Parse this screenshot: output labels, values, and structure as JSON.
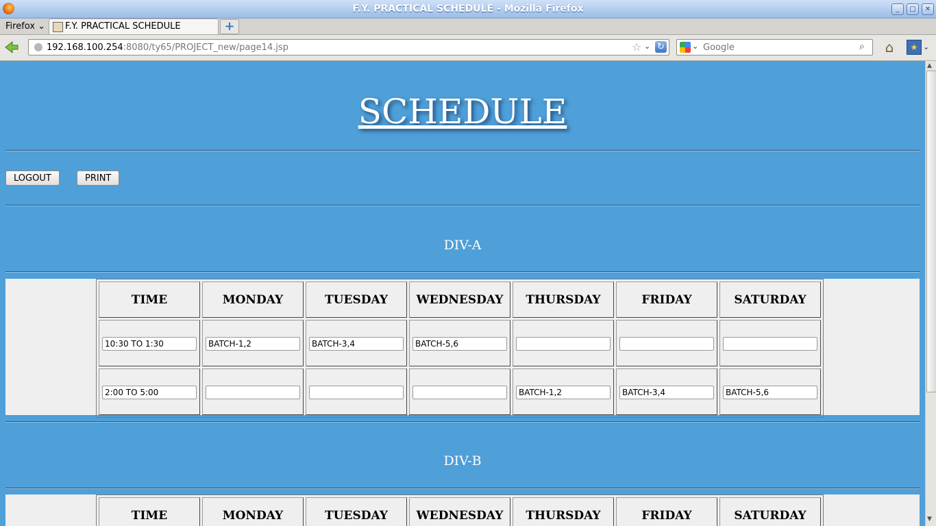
{
  "window": {
    "title": "F.Y. PRACTICAL SCHEDULE - Mozilla Firefox",
    "firefox_menu": "Firefox",
    "tab_title": "F.Y. PRACTICAL SCHEDULE",
    "url_host": "192.168.100.254",
    "url_path": ":8080/ty65/PROJECT_new/page14.jsp",
    "search_placeholder": "Google"
  },
  "page": {
    "heading": "SCHEDULE",
    "logout_label": "LOGOUT",
    "print_label": "PRINT"
  },
  "days": [
    "TIME",
    "MONDAY",
    "TUESDAY",
    "WEDNESDAY",
    "THURSDAY",
    "FRIDAY",
    "SATURDAY"
  ],
  "divisions": [
    {
      "name": "DIV-A",
      "rows": [
        [
          "10:30 TO 1:30",
          "BATCH-1,2",
          "BATCH-3,4",
          "BATCH-5,6",
          "",
          "",
          ""
        ],
        [
          "2:00 TO 5:00",
          "",
          "",
          "",
          "BATCH-1,2",
          "BATCH-3,4",
          "BATCH-5,6"
        ]
      ]
    },
    {
      "name": "DIV-B",
      "rows": []
    }
  ]
}
